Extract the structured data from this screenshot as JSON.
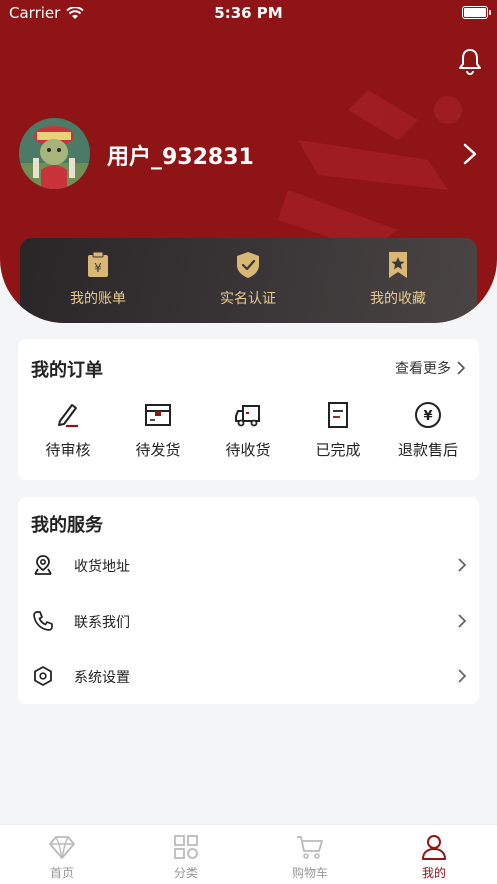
{
  "status_bar": {
    "carrier": "Carrier",
    "time": "5:36 PM"
  },
  "profile": {
    "username": "用户_932831"
  },
  "quick_actions": [
    {
      "label": "我的账单",
      "icon": "bill-icon"
    },
    {
      "label": "实名认证",
      "icon": "verified-shield-icon"
    },
    {
      "label": "我的收藏",
      "icon": "bookmark-star-icon"
    }
  ],
  "orders": {
    "title": "我的订单",
    "more_label": "查看更多",
    "items": [
      {
        "label": "待审核",
        "icon": "pen-icon"
      },
      {
        "label": "待发货",
        "icon": "package-box-icon"
      },
      {
        "label": "待收货",
        "icon": "truck-icon"
      },
      {
        "label": "已完成",
        "icon": "document-icon"
      },
      {
        "label": "退款售后",
        "icon": "yen-circle-icon"
      }
    ]
  },
  "services": {
    "title": "我的服务",
    "items": [
      {
        "label": "收货地址",
        "icon": "location-pin-icon"
      },
      {
        "label": "联系我们",
        "icon": "phone-icon"
      },
      {
        "label": "系统设置",
        "icon": "settings-hexagon-icon"
      }
    ]
  },
  "tabbar": {
    "items": [
      {
        "label": "首页",
        "icon": "diamond-icon",
        "active": false
      },
      {
        "label": "分类",
        "icon": "grid-icon",
        "active": false
      },
      {
        "label": "购物车",
        "icon": "cart-icon",
        "active": false
      },
      {
        "label": "我的",
        "icon": "user-icon",
        "active": true
      }
    ]
  },
  "colors": {
    "primary": "#8f1416",
    "gold": "#d9b774",
    "background": "#f4f5f7"
  }
}
